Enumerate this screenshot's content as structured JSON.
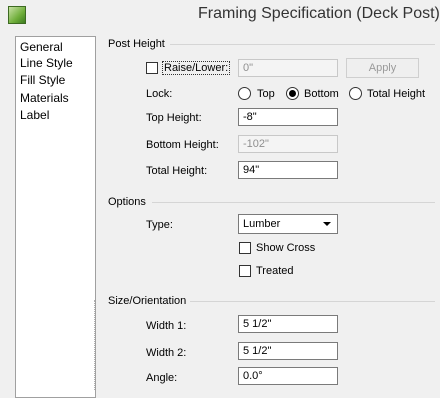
{
  "window": {
    "title": "Framing Specification (Deck Post)"
  },
  "sidebar": {
    "items": [
      {
        "label": "General"
      },
      {
        "label": "Line Style"
      },
      {
        "label": "Fill Style"
      },
      {
        "label": "Materials"
      },
      {
        "label": "Label"
      }
    ]
  },
  "post_height": {
    "title": "Post Height",
    "raise_lower": {
      "label": "Raise/Lower:",
      "checked": false,
      "value": "0\""
    },
    "apply_label": "Apply",
    "lock": {
      "label": "Lock:",
      "options": [
        "Top",
        "Bottom",
        "Total Height"
      ],
      "selected": "Bottom"
    },
    "top_height": {
      "label": "Top Height:",
      "value": "-8\""
    },
    "bottom_height": {
      "label": "Bottom Height:",
      "value": "-102\""
    },
    "total_height": {
      "label": "Total Height:",
      "value": "94\""
    }
  },
  "options": {
    "title": "Options",
    "type": {
      "label": "Type:",
      "value": "Lumber"
    },
    "show_cross": {
      "label": "Show Cross",
      "checked": false
    },
    "treated": {
      "label": "Treated",
      "checked": false
    }
  },
  "size_orientation": {
    "title": "Size/Orientation",
    "width1": {
      "label": "Width 1:",
      "value": "5 1/2\""
    },
    "width2": {
      "label": "Width 2:",
      "value": "5 1/2\""
    },
    "angle": {
      "label": "Angle:",
      "value": "0.0°"
    }
  }
}
